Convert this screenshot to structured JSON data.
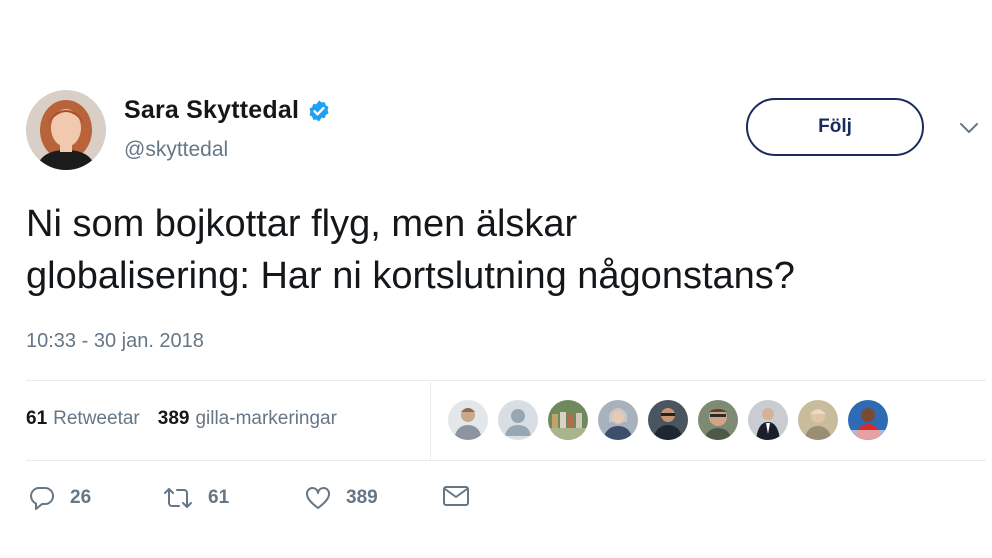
{
  "user": {
    "name": "Sara Skyttedal",
    "handle": "@skyttedal",
    "verified": true
  },
  "follow_label": "Följ",
  "tweet": {
    "text": "Ni som bojkottar flyg, men älskar\nglobalisering: Har ni kortslutning någonstans?",
    "timestamp": "10:33 - 30 jan. 2018"
  },
  "stats": {
    "retweets_count": "61",
    "retweets_label": "Retweetar",
    "likes_count": "389",
    "likes_label": "gilla-markeringar"
  },
  "actions": {
    "replies": "26",
    "retweets": "61",
    "likes": "389"
  },
  "colors": {
    "verified": "#1da1f2",
    "follow_border": "#1c2b5e",
    "secondary_text": "#657786",
    "divider": "#e6ecf0"
  },
  "icons": [
    "verified-badge-icon",
    "chevron-down-icon",
    "reply-icon",
    "retweet-icon",
    "heart-icon",
    "envelope-icon"
  ]
}
